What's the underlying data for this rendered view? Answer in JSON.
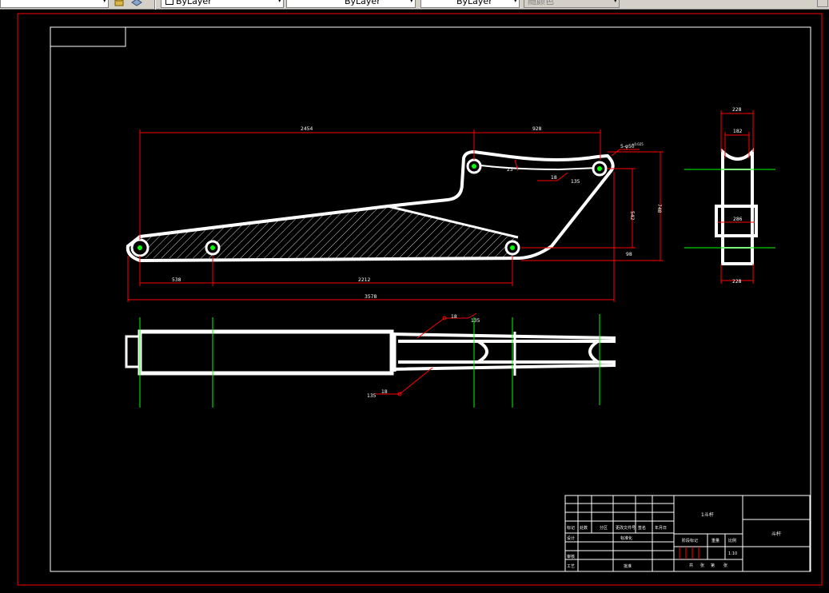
{
  "toolbar": {
    "layer_field_text": "",
    "color_label": "ByLayer",
    "linetype_label": "ByLayer",
    "lineweight_label": "ByLayer",
    "plotstyle_label": "随颜色"
  },
  "colors": {
    "background": "#000000",
    "geometry": "#ffffff",
    "dimension": "#ff0000",
    "centerline": "#00ff00",
    "border_outer": "#ff0000",
    "border_inner": "#ffffff"
  },
  "dimensions": {
    "d2454": "2454",
    "d928": "928",
    "d5phi": "5-φ50",
    "d5phi_sup": "+0.025",
    "d23": "23",
    "d18a": "18",
    "d135a": "135",
    "d542": "542",
    "d748": "748",
    "d98": "98",
    "d538": "538",
    "d2212": "2212",
    "d3578": "3578",
    "d18b": "18",
    "d135b": "135",
    "d18c": "18",
    "d135c": "135",
    "d228top": "228",
    "d182": "182",
    "d286": "286",
    "d228bot": "228"
  },
  "title_block": {
    "drawing_name": "1斗杆",
    "part_label": "斗杆",
    "scale": "1:10",
    "row_labels": {
      "biaoji": "标记",
      "chushu": "处数",
      "fenqu": "分区",
      "gengai": "更改文件号",
      "qianming": "签名",
      "nianyueri": "年月日",
      "sheji": "设计",
      "biaozhunhua": "标准化",
      "jieduan": "阶段标记",
      "zhongliang": "重量",
      "bili": "比例",
      "shenhe": "审核",
      "gongyi": "工艺",
      "pizhun": "批准",
      "gong": "共",
      "zhang": "张",
      "di": "第",
      "zhang2": "张"
    }
  }
}
